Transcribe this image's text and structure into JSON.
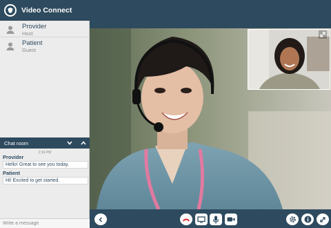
{
  "app": {
    "title": "Video Connect"
  },
  "participants": [
    {
      "name": "Provider",
      "role": "Host"
    },
    {
      "name": "Patient",
      "role": "Guest"
    }
  ],
  "chat": {
    "title": "Chat room",
    "timestamp": "2:16 PM",
    "messages": [
      {
        "sender": "Provider",
        "text": "Hello! Great to see you today."
      },
      {
        "sender": "Patient",
        "text": "Hi! Excited to get started."
      }
    ],
    "input_placeholder": "Write a message"
  },
  "controls": {
    "icons": [
      "chevron-left-icon",
      "hang-up-icon",
      "screen-share-icon",
      "microphone-icon",
      "camera-icon",
      "settings-icon",
      "info-icon",
      "fullscreen-icon"
    ]
  },
  "colors": {
    "brand": "#2e4a5e",
    "hangup": "#d9252a"
  }
}
